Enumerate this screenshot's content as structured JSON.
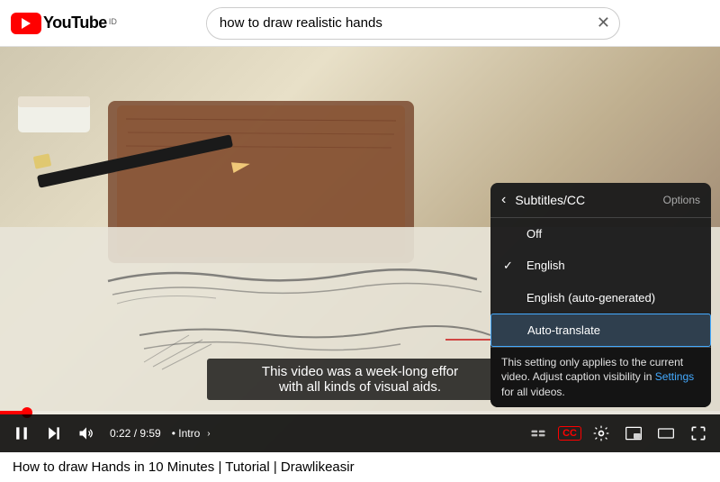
{
  "header": {
    "logo_text": "YouTube",
    "logo_superscript": "ID",
    "search_value": "how to draw realistic hands",
    "clear_button": "✕"
  },
  "video": {
    "caption_line1": "This video was a week-long effor",
    "caption_line2": "with all kinds of visual aids.",
    "time_current": "0:22",
    "time_total": "9:59",
    "chapter": "Intro",
    "chapter_chevron": "›"
  },
  "subtitles_panel": {
    "back_label": "‹",
    "title": "Subtitles/CC",
    "options_label": "Options",
    "items": [
      {
        "id": "off",
        "label": "Off",
        "checked": false,
        "selected": false
      },
      {
        "id": "english",
        "label": "English",
        "checked": true,
        "selected": false
      },
      {
        "id": "english-auto",
        "label": "English (auto-generated)",
        "checked": false,
        "selected": false
      },
      {
        "id": "auto-translate",
        "label": "Auto-translate",
        "checked": false,
        "selected": true
      }
    ],
    "tooltip": "This setting only applies to the current video. Adjust caption visibility in ",
    "tooltip_link": "Settings",
    "tooltip_end": " for all videos."
  },
  "video_title": "How to draw Hands in 10 Minutes | Tutorial | Drawlikeasir",
  "controls": {
    "play_label": "⏸",
    "skip_label": "⏭",
    "volume_label": "🔊",
    "settings_label": "⚙",
    "captions_label": "CC",
    "miniplayer_label": "⊡",
    "theater_label": "▭",
    "fullscreen_label": "⛶"
  }
}
